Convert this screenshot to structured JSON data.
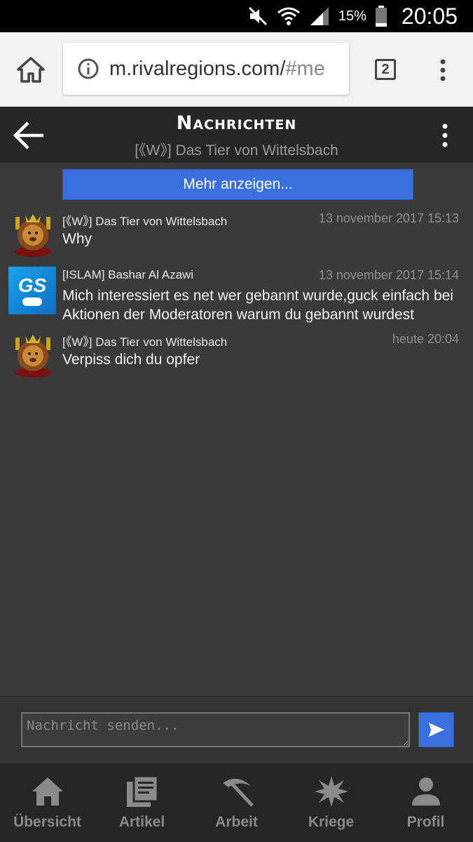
{
  "status_bar": {
    "battery_percent": "15%",
    "time": "20:05",
    "icons": [
      "mute-icon",
      "wifi-icon",
      "signal-icon",
      "battery-icon"
    ]
  },
  "browser": {
    "url_main": "m.rivalregions.com/",
    "url_rest": "#me",
    "tab_count": "2",
    "icons": [
      "home-icon",
      "info-icon",
      "tabs-icon",
      "more-vert-icon"
    ]
  },
  "header": {
    "title": "Nachrichten",
    "subtitle": "[《W》] Das Tier von Wittelsbach"
  },
  "more_button": "Mehr anzeigen...",
  "messages": [
    {
      "sender": "[《W》] Das Tier von Wittelsbach",
      "time": "13 november 2017 15:13",
      "text": "Why",
      "avatar": "lion-avatar"
    },
    {
      "sender": "[ISLAM] Bashar Al Azawi",
      "time": "13 november 2017 15:14",
      "text": "Mich interessiert es net wer gebannt wurde,guck einfach bei Aktionen der Moderatoren warum du gebannt wurdest",
      "avatar": "gs-avatar",
      "avatar_text": "GS"
    },
    {
      "sender": "[《W》] Das Tier von Wittelsbach",
      "time": "heute 20:04",
      "text": "Verpiss dich du opfer",
      "avatar": "lion-avatar"
    }
  ],
  "compose": {
    "placeholder": "Nachricht senden..."
  },
  "nav": [
    {
      "label": "Übersicht",
      "icon": "home-icon"
    },
    {
      "label": "Artikel",
      "icon": "article-icon"
    },
    {
      "label": "Arbeit",
      "icon": "pickaxe-icon"
    },
    {
      "label": "Kriege",
      "icon": "explosion-icon"
    },
    {
      "label": "Profil",
      "icon": "person-icon"
    }
  ],
  "colors": {
    "accent": "#3b6fe0",
    "background": "#3a3a3a",
    "header": "#272727",
    "nav": "#262626"
  }
}
